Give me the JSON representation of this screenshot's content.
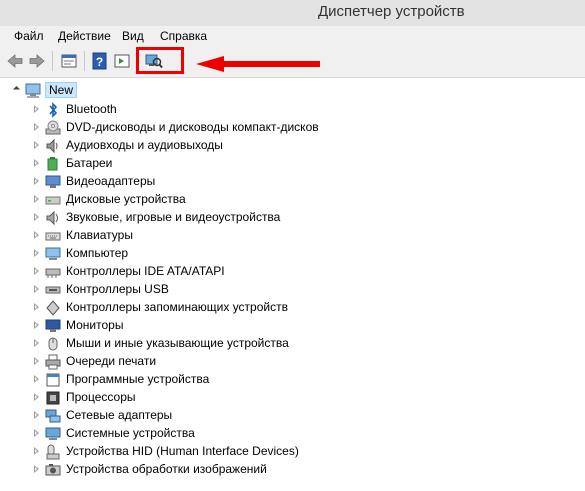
{
  "window": {
    "title": "Диспетчер устройств"
  },
  "menu": [
    "Файл",
    "Действие",
    "Вид",
    "Справка"
  ],
  "toolbar": {
    "icons": [
      "back-arrow-icon",
      "forward-arrow-icon",
      "properties-panel-icon",
      "help-icon",
      "action-panel-icon",
      "scan-hardware-icon"
    ]
  },
  "tree": {
    "root": {
      "label": "New",
      "icon": "computer-icon",
      "expanded": true,
      "selected": true
    },
    "categories": [
      {
        "label": "Bluetooth",
        "icon": "bluetooth-icon"
      },
      {
        "label": "DVD-дисководы и дисководы компакт-дисков",
        "icon": "dvd-drive-icon"
      },
      {
        "label": "Аудиовходы и аудиовыходы",
        "icon": "audio-io-icon"
      },
      {
        "label": "Батареи",
        "icon": "battery-icon"
      },
      {
        "label": "Видеоадаптеры",
        "icon": "display-adapter-icon"
      },
      {
        "label": "Дисковые устройства",
        "icon": "disk-drive-icon"
      },
      {
        "label": "Звуковые, игровые и видеоустройства",
        "icon": "sound-icon"
      },
      {
        "label": "Клавиатуры",
        "icon": "keyboard-icon"
      },
      {
        "label": "Компьютер",
        "icon": "computer-icon"
      },
      {
        "label": "Контроллеры IDE ATA/ATAPI",
        "icon": "ide-controller-icon"
      },
      {
        "label": "Контроллеры USB",
        "icon": "usb-controller-icon"
      },
      {
        "label": "Контроллеры запоминающих устройств",
        "icon": "storage-controller-icon"
      },
      {
        "label": "Мониторы",
        "icon": "monitor-icon"
      },
      {
        "label": "Мыши и иные указывающие устройства",
        "icon": "mouse-icon"
      },
      {
        "label": "Очереди печати",
        "icon": "print-queue-icon"
      },
      {
        "label": "Программные устройства",
        "icon": "software-device-icon"
      },
      {
        "label": "Процессоры",
        "icon": "processor-icon"
      },
      {
        "label": "Сетевые адаптеры",
        "icon": "network-adapter-icon"
      },
      {
        "label": "Системные устройства",
        "icon": "system-device-icon"
      },
      {
        "label": "Устройства HID (Human Interface Devices)",
        "icon": "hid-icon"
      },
      {
        "label": "Устройства обработки изображений",
        "icon": "imaging-device-icon"
      }
    ]
  },
  "colors": {
    "highlight": "#ee0000",
    "selection": "#cce8ff",
    "toolbar_bg": "#f0f0f0"
  }
}
